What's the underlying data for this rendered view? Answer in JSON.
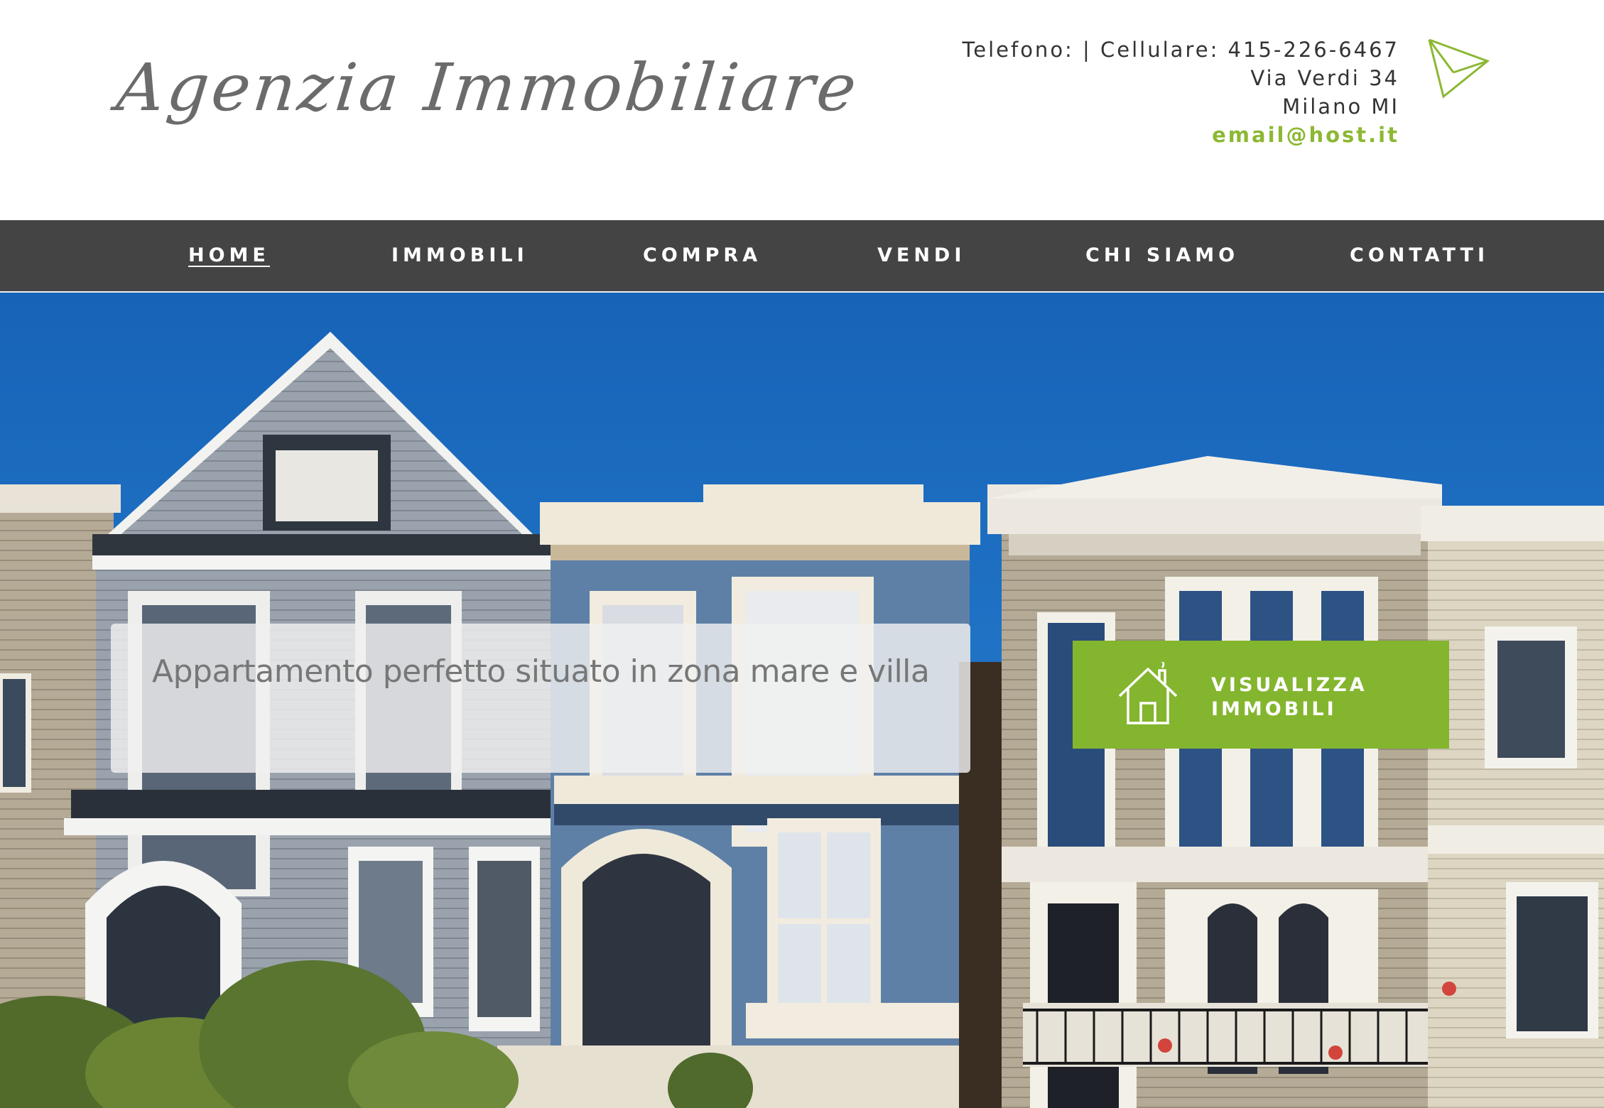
{
  "header": {
    "logo": "Agenzia Immobiliare",
    "phone_line": "Telefono: |  Cellulare: 415-226-6467",
    "address_street": "Via Verdi 34",
    "address_city": "Milano MI",
    "email": "email@host.it"
  },
  "nav": {
    "items": [
      {
        "label": "HOME"
      },
      {
        "label": "IMMOBILI"
      },
      {
        "label": "COMPRA"
      },
      {
        "label": "VENDI"
      },
      {
        "label": "CHI SIAMO"
      },
      {
        "label": "CONTATTI"
      }
    ],
    "active_index": 0
  },
  "hero": {
    "tagline": "Appartamento perfetto situato in zona mare e villa",
    "cta": {
      "line1": "VISUALIZZA",
      "line2": "IMMOBILI",
      "icon": "house-icon"
    }
  },
  "colors": {
    "accent": "#84b52f",
    "nav_background": "#444444",
    "logo_text": "#6b6b6b",
    "sky": "#1a6fc4"
  }
}
